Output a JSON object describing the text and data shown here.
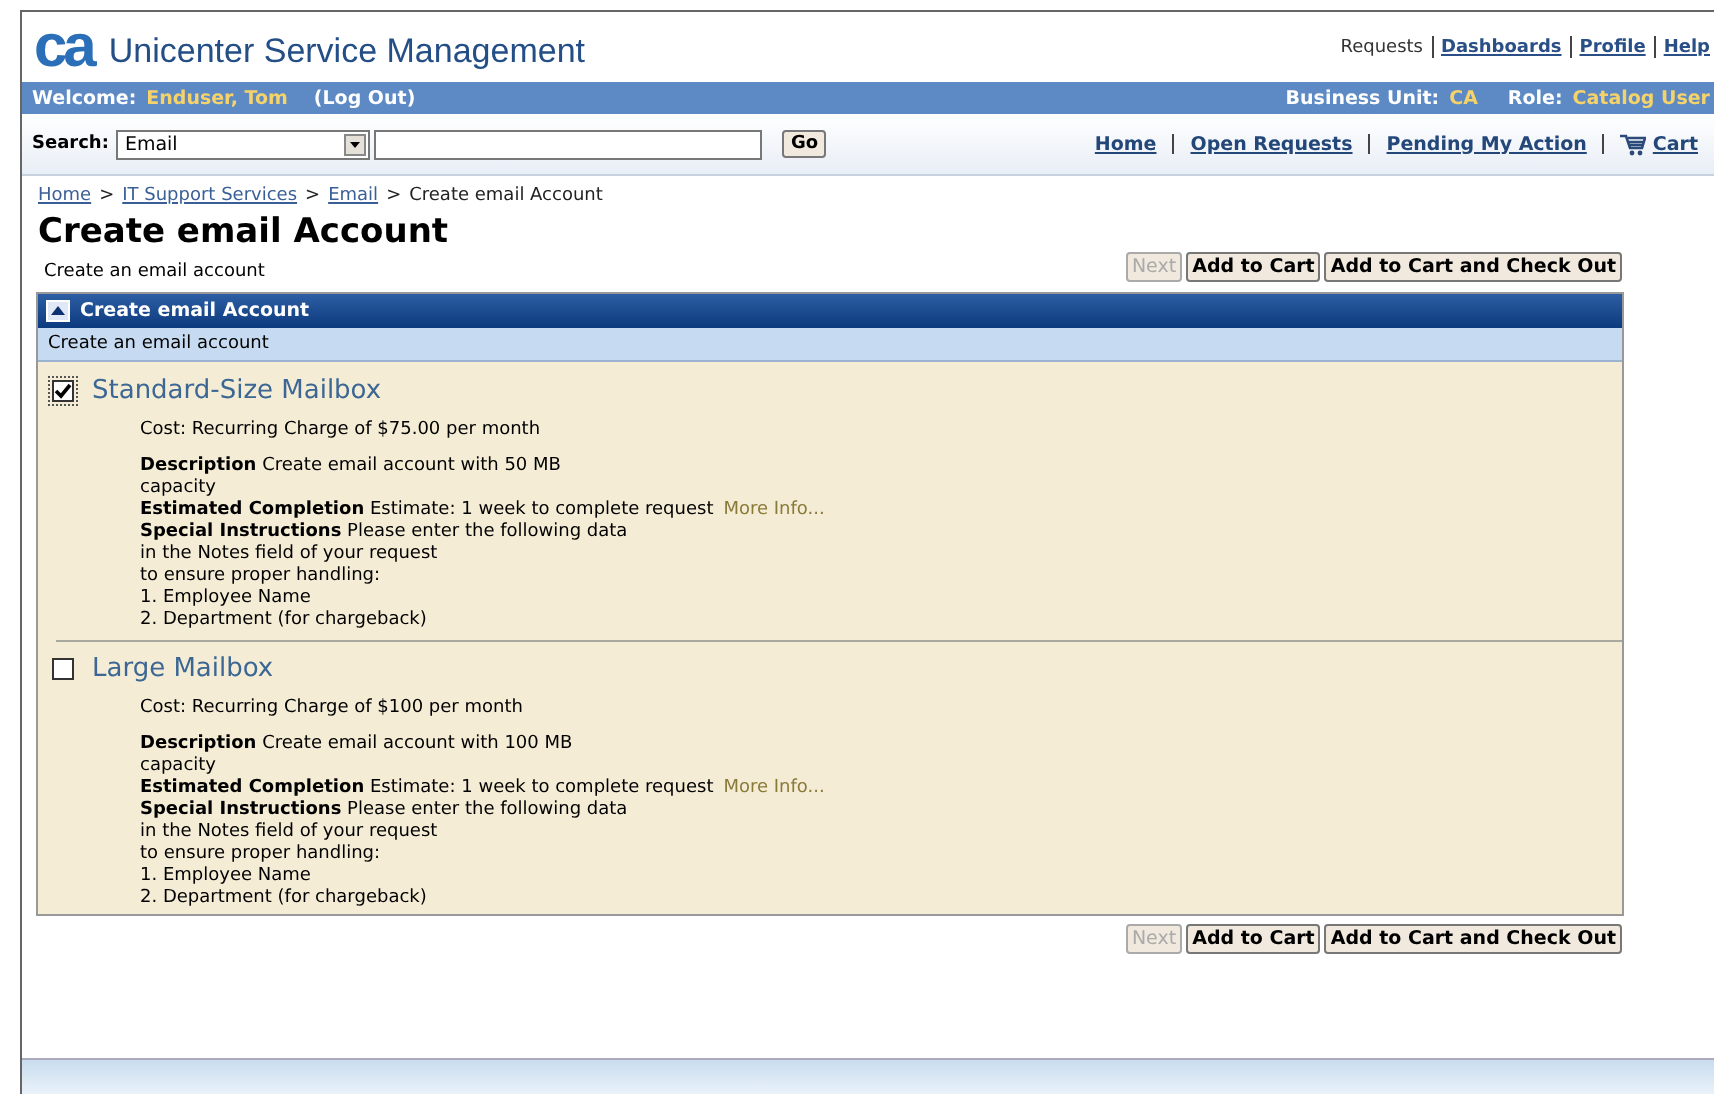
{
  "header": {
    "logo": "ca",
    "title": "Unicenter Service Management",
    "links": [
      {
        "label": "Requests",
        "underlined": false
      },
      {
        "label": "Dashboards",
        "underlined": true
      },
      {
        "label": "Profile",
        "underlined": true
      },
      {
        "label": "Help",
        "underlined": true
      }
    ]
  },
  "user_bar": {
    "welcome_label": "Welcome:",
    "user": "Enduser, Tom",
    "logout": "(Log Out)",
    "unit_label": "Business Unit:",
    "unit": "CA",
    "role_label": "Role:",
    "role": "Catalog User"
  },
  "search": {
    "label": "Search:",
    "category": "Email",
    "button": "Go"
  },
  "nav": [
    {
      "label": "Home",
      "kind": "link"
    },
    {
      "label": "Open Requests",
      "kind": "link"
    },
    {
      "label": "Pending My Action",
      "kind": "link"
    },
    {
      "label": "Cart",
      "kind": "cart"
    }
  ],
  "breadcrumb": {
    "separator": ">",
    "items": [
      {
        "label": "Home",
        "link": true
      },
      {
        "label": "IT Support Services",
        "link": true
      },
      {
        "label": "Email",
        "link": true
      },
      {
        "label": "Create email Account",
        "link": false
      }
    ]
  },
  "page_title": "Create email Account",
  "page_subtitle": "Create an email account",
  "buttons": [
    {
      "label": "Next",
      "disabled": true
    },
    {
      "label": "Add to Cart",
      "disabled": false
    },
    {
      "label": "Add to Cart and Check Out",
      "disabled": false
    }
  ],
  "panel": {
    "title": "Create email Account",
    "expanded": true,
    "subtitle": "Create an email account",
    "items": [
      {
        "name": "Standard-Size Mailbox",
        "checked": true,
        "cost": "Cost: Recurring Charge of $75.00 per month",
        "description": "**Description**  Create email account with 50 MB\ncapacity",
        "estimate": "**Estimated Completion**  Estimate: 1 week to complete request",
        "more_info": "More Info...",
        "instructions": "**Special Instructions**  Please enter the following data\nin the Notes field of your request\nto ensure proper handling:\n1. Employee Name\n2. Department (for chargeback)"
      },
      {
        "name": "Large Mailbox",
        "checked": false,
        "cost": "Cost: Recurring Charge of $100 per month",
        "description": "**Description**  Create email account with 100 MB\ncapacity",
        "estimate": "**Estimated Completion**  Estimate: 1 week to complete request",
        "more_info": "More Info...",
        "instructions": "**Special Instructions**  Please enter the following data\nin the Notes field of your request\nto ensure proper handling:\n1. Employee Name\n2. Department (for chargeback)"
      }
    ]
  },
  "bottom_buttons": [
    {
      "label": "Next",
      "disabled": true
    },
    {
      "label": "Add to Cart",
      "disabled": false
    },
    {
      "label": "Add to Cart and Check Out",
      "disabled": false
    }
  ]
}
